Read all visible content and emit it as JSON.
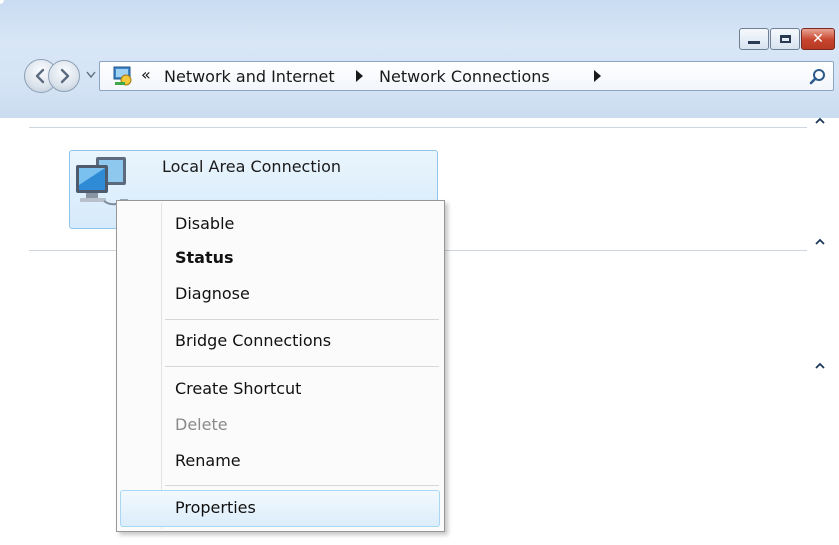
{
  "window": {
    "controls": {
      "minimize": "minimize",
      "maximize": "maximize",
      "close": "close"
    }
  },
  "address": {
    "overflow": "«",
    "crumbs": [
      "Network and Internet",
      "Network Connections"
    ]
  },
  "connection": {
    "name": "Local Area Connection"
  },
  "context_menu": {
    "items": [
      {
        "label": "Disable",
        "state": "normal"
      },
      {
        "label": "Status",
        "state": "default"
      },
      {
        "label": "Diagnose",
        "state": "normal"
      },
      {
        "label": "Bridge Connections",
        "state": "normal"
      },
      {
        "label": "Create Shortcut",
        "state": "normal"
      },
      {
        "label": "Delete",
        "state": "disabled"
      },
      {
        "label": "Rename",
        "state": "normal"
      },
      {
        "label": "Properties",
        "state": "hovered"
      }
    ]
  },
  "icons": {
    "back": "back-arrow-icon",
    "forward": "forward-arrow-icon",
    "address": "control-panel-icon",
    "search": "search-icon",
    "network": "network-computer-icon"
  },
  "colors": {
    "chrome": "#d5e4f5",
    "selection_border": "#92c5ea",
    "close_button": "#c7442d",
    "menu_hover": "#dcedfb"
  }
}
